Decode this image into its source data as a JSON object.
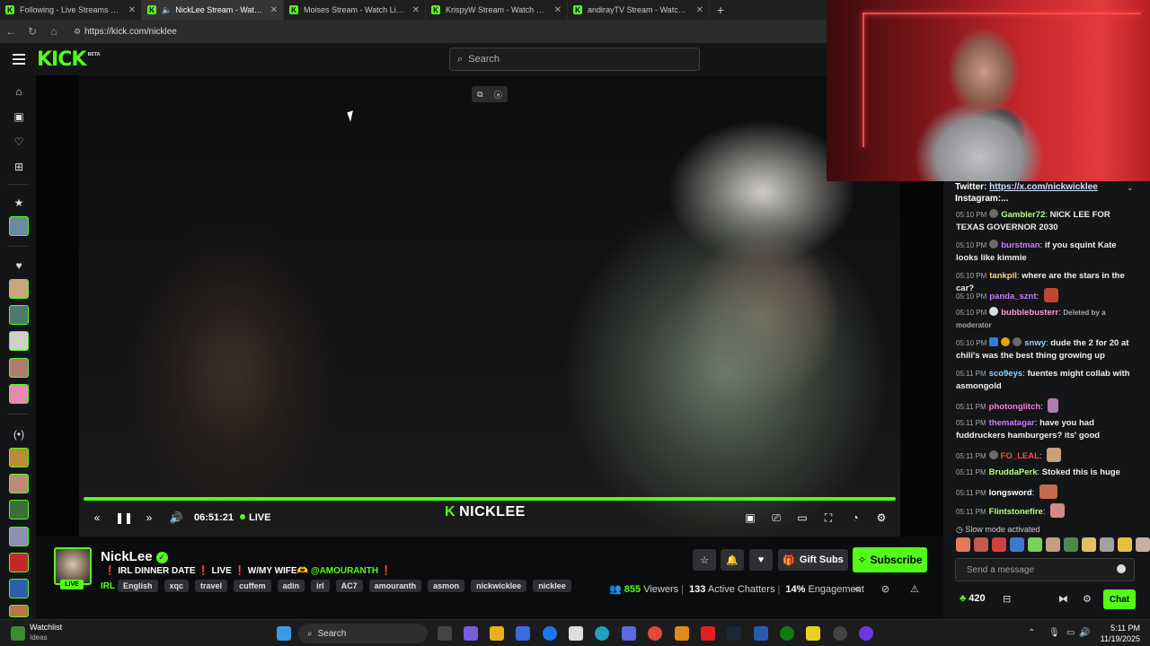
{
  "browser": {
    "tabs": [
      {
        "title": "Following - Live Streams on Kick",
        "active": false,
        "audio": false
      },
      {
        "title": "NickLee Stream - Watch Live on Kick",
        "active": true,
        "audio": true
      },
      {
        "title": "Moises Stream - Watch Live on Kick",
        "active": false,
        "audio": false
      },
      {
        "title": "KrispyW Stream - Watch Live on Kick",
        "active": false,
        "audio": false
      },
      {
        "title": "andirayTV Stream - Watch Live on Kick",
        "active": false,
        "audio": false
      }
    ],
    "url": "https://kick.com/nicklee"
  },
  "header": {
    "logo": "KICK",
    "logo_badge": "BETA",
    "search_placeholder": "Search"
  },
  "player": {
    "time": "06:51:21",
    "live_label": "LIVE",
    "watermark": "NICKLEE",
    "progress": 1.0
  },
  "stream": {
    "username": "NickLee",
    "live_badge": "LIVE",
    "title_prefix": "❗ IRL DINNER DATE ❗ LIVE ❗ W/MY WIFE🫶",
    "title_mention": "@AMOURANTH",
    "title_suffix": "❗",
    "category": "IRL",
    "tags": [
      "English",
      "xqc",
      "travel",
      "cuffem",
      "adin",
      "irl",
      "AC7",
      "amouranth",
      "asmon",
      "nickwicklee",
      "nicklee"
    ],
    "gift_label": "Gift Subs",
    "subscribe_label": "Subscribe",
    "viewers": "855",
    "viewers_label": "Viewers",
    "chatters": "133",
    "chatters_label": "Active Chatters",
    "engagement": "14%",
    "engagement_label": "Engagement"
  },
  "chat": {
    "about_line1_label": "Twitter:",
    "about_line1_link": "https://x.com/nickwicklee",
    "about_line2": "Instagram:...",
    "messages": [
      {
        "time": "05:10 PM",
        "user": "Gambler72",
        "color": "#b6ff7a",
        "text": "NICK LEE FOR TEXAS GOVERNOR 2030"
      },
      {
        "time": "05:10 PM",
        "user": "burstman",
        "color": "#c97dff",
        "text": "if you squint Kate looks like kimmie"
      },
      {
        "time": "05:10 PM",
        "user": "tankpil",
        "color": "#ffd27a",
        "text": "where are the stars in the car?"
      },
      {
        "time": "05:10 PM",
        "user": "panda_sznt",
        "color": "#c97dff",
        "text": ""
      },
      {
        "time": "05:10 PM",
        "user": "bubblebusterr",
        "color": "#ff9bd2",
        "text": "Deleted by a moderator"
      },
      {
        "time": "05:10 PM",
        "user": "snwy",
        "color": "#8fd3ff",
        "text": "dude the 2 for 20 at chili's was the best thing growing up"
      },
      {
        "time": "05:11 PM",
        "user": "sco9eys",
        "color": "#8fd3ff",
        "text": "fuentes might collab with asmongold"
      },
      {
        "time": "05:11 PM",
        "user": "photonglitch",
        "color": "#ff7ad9",
        "text": ""
      },
      {
        "time": "05:11 PM",
        "user": "thematagar",
        "color": "#c97dff",
        "text": "have you had fuddruckers hamburgers? its' good"
      },
      {
        "time": "05:11 PM",
        "user": "FO_LEAL",
        "color": "#ff4b4b",
        "text": ""
      },
      {
        "time": "05:11 PM",
        "user": "BruddaPerk",
        "color": "#b6ff7a",
        "text": "Stoked this is huge"
      },
      {
        "time": "05:11 PM",
        "user": "longsword",
        "color": "#ffffff",
        "text": ""
      },
      {
        "time": "05:11 PM",
        "user": "Flintstonefire",
        "color": "#b6ff7a",
        "text": ""
      }
    ],
    "slow_mode": "Slow mode activated",
    "send_placeholder": "Send a message",
    "points": "420",
    "chat_button": "Chat"
  },
  "taskbar": {
    "watchlist": "Watchlist",
    "watchlist_sub": "Ideas",
    "search": "Search",
    "time": "5:11 PM",
    "date": "11/19/2025"
  },
  "colors": {
    "kick_green": "#53fc18",
    "bg": "#0b0c0d",
    "panel": "#141517"
  }
}
